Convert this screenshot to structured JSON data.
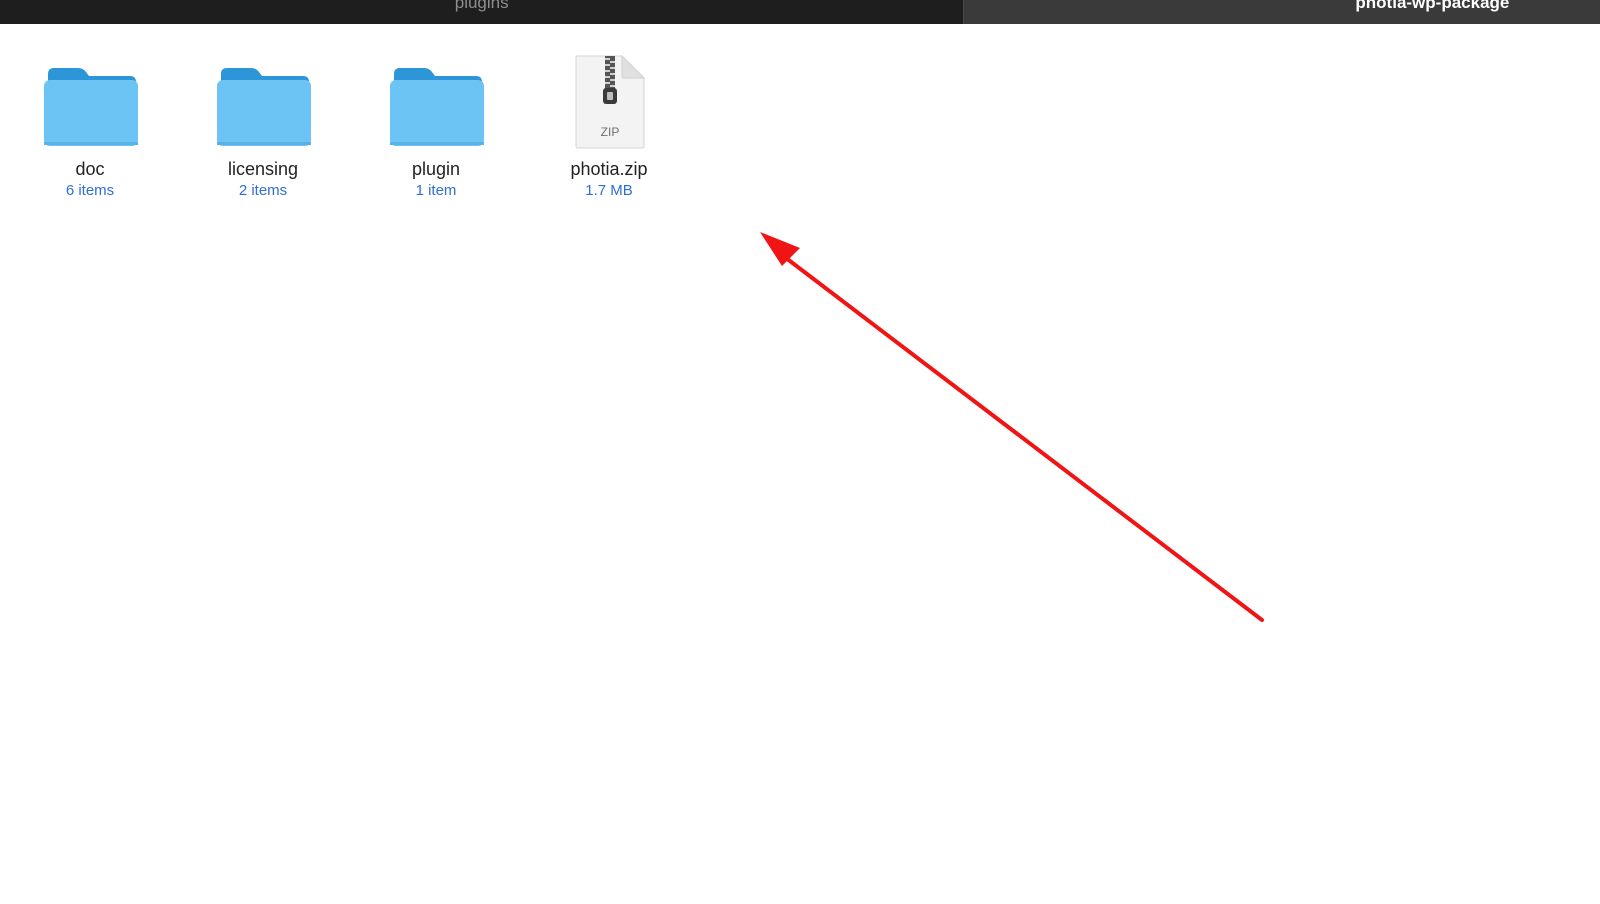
{
  "tabs": [
    {
      "label": "plugins",
      "active": false
    },
    {
      "label": "photia-wp-package",
      "active": true
    }
  ],
  "items": [
    {
      "name": "doc",
      "meta": "6 items",
      "kind": "folder-icon"
    },
    {
      "name": "licensing",
      "meta": "2 items",
      "kind": "folder-icon"
    },
    {
      "name": "plugin",
      "meta": "1 item",
      "kind": "folder-icon"
    },
    {
      "name": "photia.zip",
      "meta": "1.7 MB",
      "kind": "zip-file-icon",
      "badge": "ZIP"
    }
  ],
  "colors": {
    "folder": "#6cc4f5",
    "folder_tab": "#2d96d9",
    "meta_text": "#2f6fd0",
    "annotation_arrow": "#f01414"
  }
}
